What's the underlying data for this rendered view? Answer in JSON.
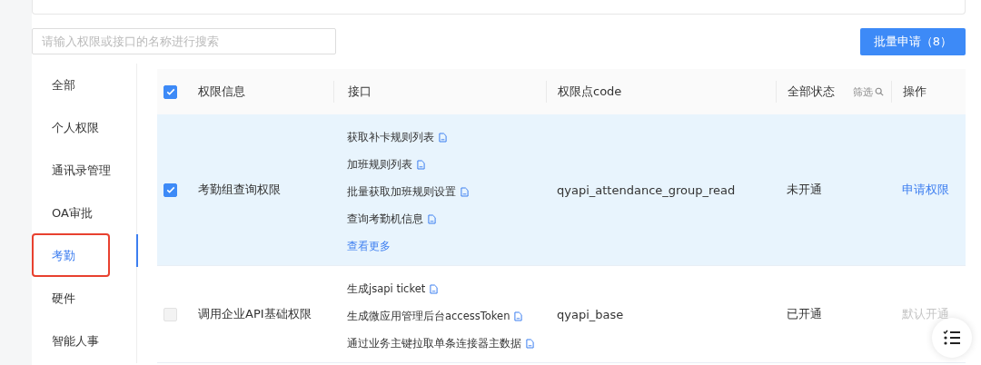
{
  "search": {
    "placeholder": "请输入权限或接口的名称进行搜索"
  },
  "batch_button": "批量申请（8）",
  "sidebar": {
    "items": [
      {
        "label": "全部",
        "selected": false,
        "highlighted": false
      },
      {
        "label": "个人权限",
        "selected": false,
        "highlighted": false
      },
      {
        "label": "通讯录管理",
        "selected": false,
        "highlighted": false
      },
      {
        "label": "OA审批",
        "selected": false,
        "highlighted": false
      },
      {
        "label": "考勤",
        "selected": true,
        "highlighted": true
      },
      {
        "label": "硬件",
        "selected": false,
        "highlighted": false
      },
      {
        "label": "智能人事",
        "selected": false,
        "highlighted": false
      }
    ]
  },
  "table": {
    "all_checked": true,
    "columns": [
      "权限信息",
      "接口",
      "权限点code",
      "全部状态",
      "操作"
    ],
    "filter": "筛选",
    "rows": [
      {
        "checked": true,
        "disabled": false,
        "selected": true,
        "name": "考勤组查询权限",
        "apis": [
          "获取补卡规则列表",
          "加班规则列表",
          "批量获取加班规则设置",
          "查询考勤机信息"
        ],
        "more": "查看更多",
        "code": "qyapi_attendance_group_read",
        "status": "未开通",
        "action": "申请权限",
        "action_disabled": false
      },
      {
        "checked": false,
        "disabled": true,
        "selected": false,
        "name": "调用企业API基础权限",
        "apis": [
          "生成jsapi ticket",
          "生成微应用管理后台accessToken",
          "通过业务主键拉取单条连接器主数据"
        ],
        "code": "qyapi_base",
        "status": "已开通",
        "action": "默认开通",
        "action_disabled": true
      }
    ]
  }
}
